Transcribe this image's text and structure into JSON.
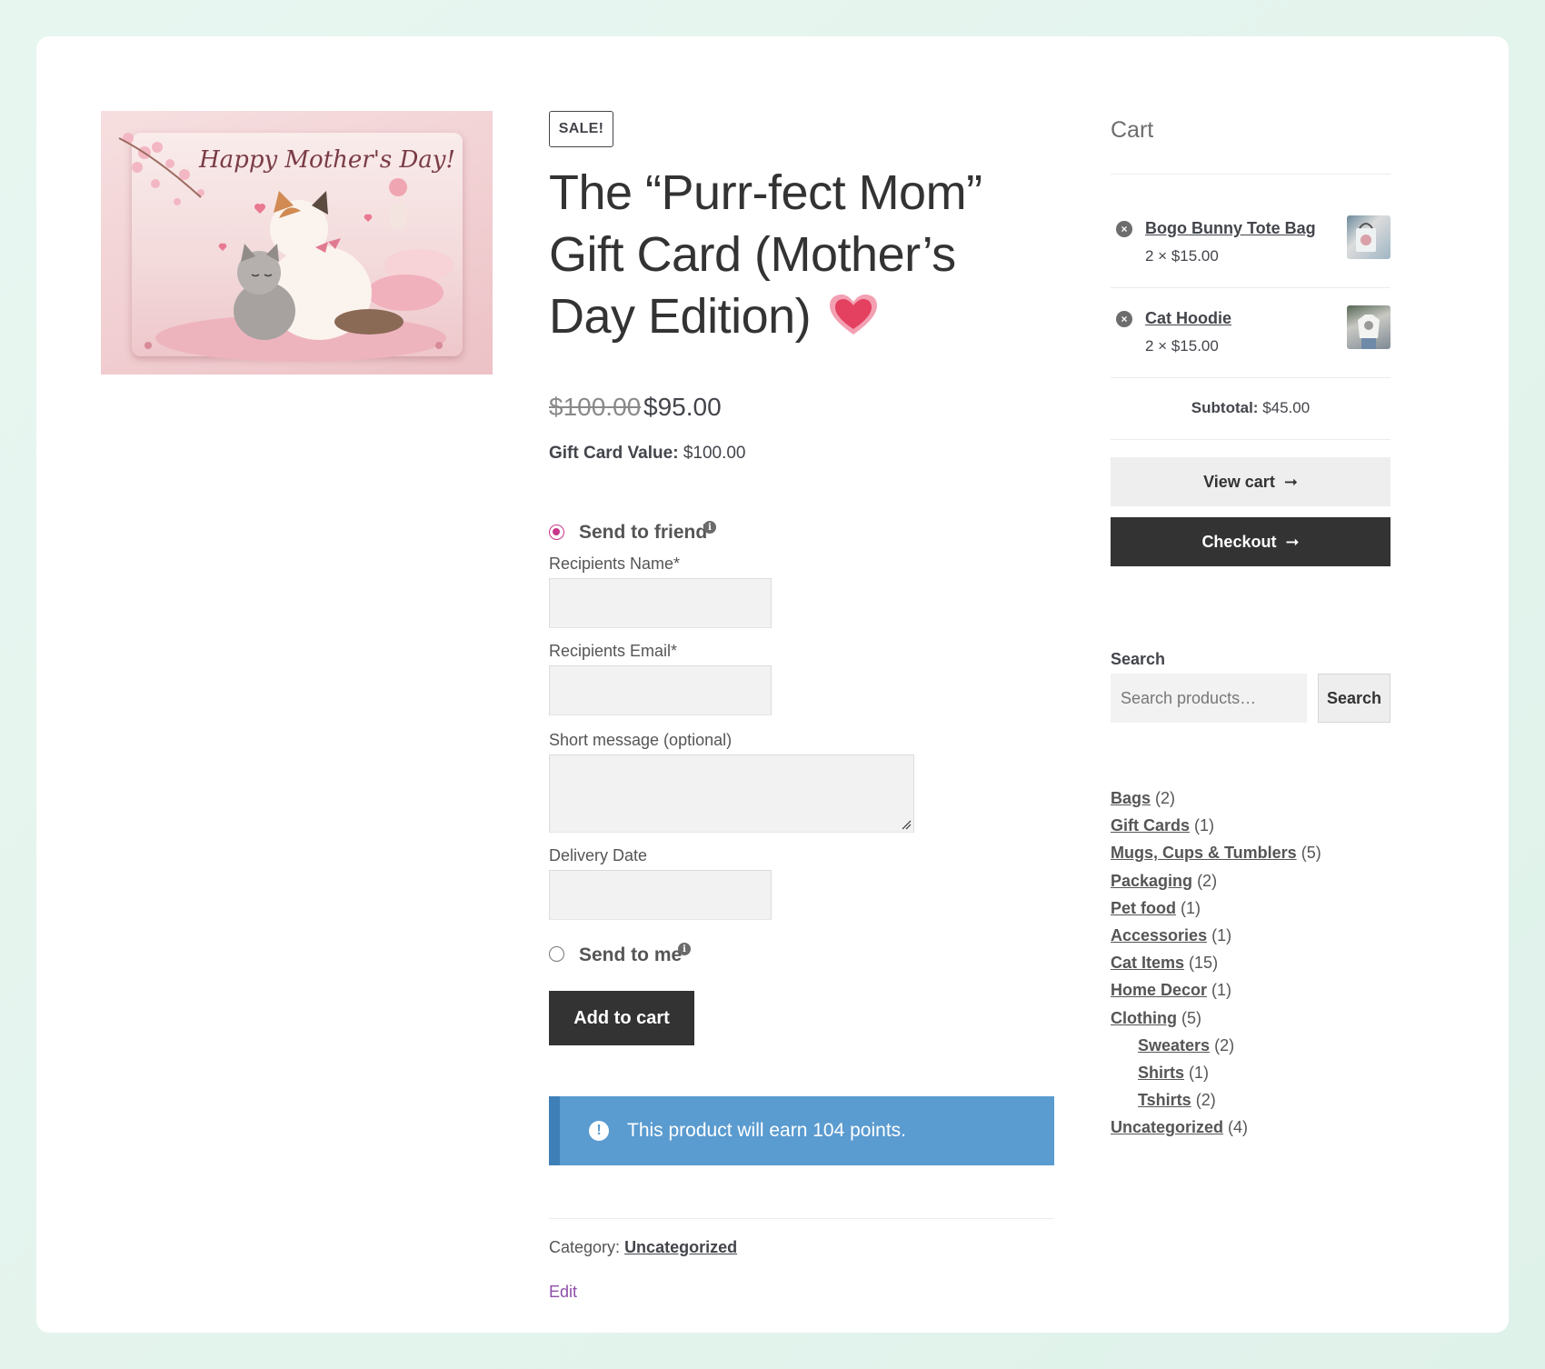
{
  "colors": {
    "accent": "#c8368a",
    "dark": "#333333",
    "notice": "#5a9bd0",
    "link_purple": "#8d4fa8"
  },
  "product": {
    "image_alt_text": "Happy Mother's Day!",
    "sale_badge": "SALE!",
    "title": "The “Purr-fect Mom” Gift Card (Mother’s Day Edition)",
    "title_emoji": "heart",
    "price_old": "$100.00",
    "price_new": "$95.00",
    "giftcard_value_label": "Gift Card Value:",
    "giftcard_value": "$100.00",
    "send_to_friend_label": "Send to friend",
    "send_to_friend_selected": true,
    "recipient_name_label": "Recipients Name*",
    "recipient_name_value": "",
    "recipient_email_label": "Recipients Email*",
    "recipient_email_value": "",
    "message_label": "Short message (optional)",
    "message_value": "",
    "delivery_date_label": "Delivery Date",
    "delivery_date_value": "",
    "send_to_me_label": "Send to me",
    "add_to_cart_label": "Add to cart",
    "points_notice": "This product will earn 104 points.",
    "category_label": "Category:",
    "category_value": "Uncategorized",
    "edit_label": "Edit"
  },
  "cart": {
    "title": "Cart",
    "items": [
      {
        "name": "Bogo Bunny Tote Bag",
        "qty": "2 × $15.00"
      },
      {
        "name": "Cat Hoodie",
        "qty": "2 × $15.00"
      }
    ],
    "subtotal_label": "Subtotal:",
    "subtotal_value": "$45.00",
    "view_cart_label": "View cart",
    "checkout_label": "Checkout"
  },
  "search": {
    "label": "Search",
    "placeholder": "Search products…",
    "button_label": "Search"
  },
  "categories": [
    {
      "name": "Bags",
      "count": "(2)"
    },
    {
      "name": "Gift Cards",
      "count": "(1)"
    },
    {
      "name": "Mugs, Cups & Tumblers",
      "count": "(5)"
    },
    {
      "name": "Packaging",
      "count": "(2)"
    },
    {
      "name": "Pet food",
      "count": "(1)"
    },
    {
      "name": "Accessories",
      "count": "(1)"
    },
    {
      "name": "Cat Items",
      "count": "(15)"
    },
    {
      "name": "Home Decor",
      "count": "(1)"
    },
    {
      "name": "Clothing",
      "count": "(5)"
    },
    {
      "name": "Sweaters",
      "count": "(2)"
    },
    {
      "name": "Shirts",
      "count": "(1)"
    },
    {
      "name": "Tshirts",
      "count": "(2)"
    },
    {
      "name": "Uncategorized",
      "count": "(4)"
    }
  ]
}
